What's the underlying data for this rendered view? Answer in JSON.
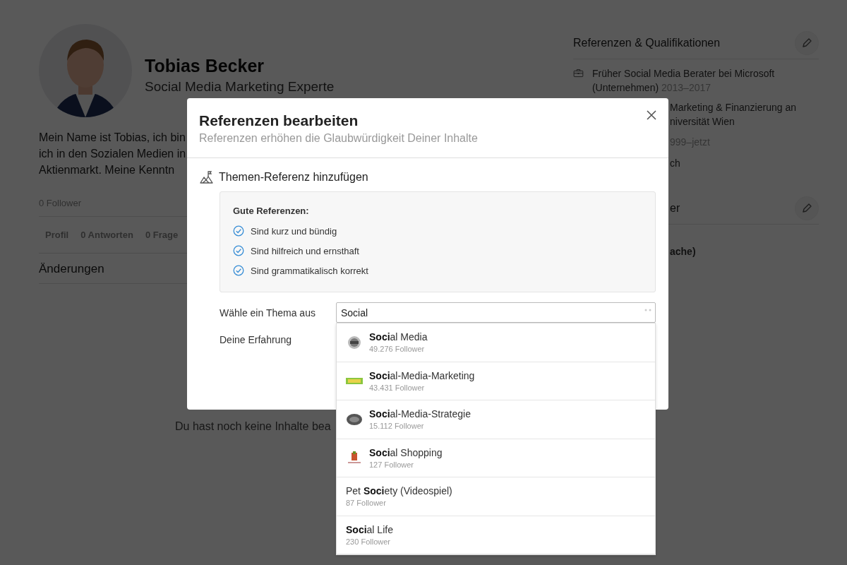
{
  "profile": {
    "name": "Tobias Becker",
    "headline": "Social Media Marketing Experte",
    "bio_lines": [
      "Mein Name ist Tobias, ich bin",
      "ich in den Sozialen Medien in",
      "Aktienmarkt. Meine Kenntn"
    ],
    "followers": "0 Follower",
    "tabs": [
      {
        "label": "Profil",
        "selected": false
      },
      {
        "label": "0 Antworten",
        "selected": false
      },
      {
        "label": "0 Frage",
        "selected": false
      }
    ],
    "section_title": "Änderungen",
    "empty_message": "Du hast noch keine Inhalte bea"
  },
  "sidebar": {
    "references": {
      "title": "Referenzen & Qualifikationen",
      "items": [
        {
          "kind": "work",
          "text": "Früher Social Media Berater bei Microsoft (Unternehmen)",
          "years": "2013–2017"
        }
      ],
      "fragments": [
        {
          "kind": "text",
          "text": "Marketing & Finanzierung an"
        },
        {
          "kind": "text",
          "text": "niversität Wien"
        },
        {
          "kind": "muted",
          "text": "999–jetzt"
        },
        {
          "kind": "text",
          "text": "ch"
        }
      ]
    },
    "second": {
      "title": "er",
      "fragments": [
        {
          "kind": "bold",
          "text": "ache)"
        }
      ]
    }
  },
  "modal": {
    "title": "Referenzen bearbeiten",
    "subtitle": "Referenzen erhöhen die Glaubwürdigkeit Deiner Inhalte",
    "section_title": "Themen-Referenz hinzufügen",
    "tips_title": "Gute Referenzen:",
    "tips": [
      "Sind kurz und bündig",
      "Sind hilfreich und ernsthaft",
      "Sind grammatikalisch korrekt"
    ],
    "topic_field": {
      "label": "Wähle ein Thema aus",
      "value": "Social",
      "suggestions": [
        {
          "name": "**Soci**al Media",
          "followers": "49.276 Follower",
          "has_image": true
        },
        {
          "name": "**Soci**al-Media-Marketing",
          "followers": "43.431 Follower",
          "has_image": true
        },
        {
          "name": "**Soci**al-Media-Strategie",
          "followers": "15.112 Follower",
          "has_image": true
        },
        {
          "name": "**Soci**al Shopping",
          "followers": "127 Follower",
          "has_image": true
        },
        {
          "name": "Pet **Soci**ety (Videospiel)",
          "followers": "87 Follower",
          "has_image": false
        },
        {
          "name": "**Soci**al Life",
          "followers": "230 Follower",
          "has_image": false
        }
      ]
    },
    "experience_field": {
      "label": "Deine Erfahrung"
    }
  }
}
